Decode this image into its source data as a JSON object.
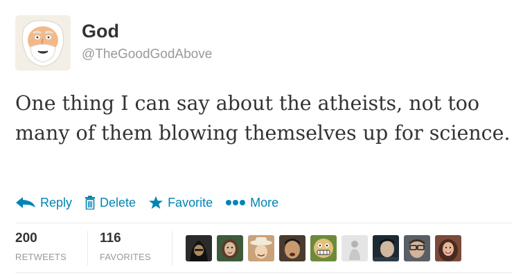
{
  "user": {
    "name": "God",
    "handle": "@TheGoodGodAbove"
  },
  "tweet": {
    "text": "One thing I can say about the atheists, not too many of them blowing themselves up for science."
  },
  "actions": [
    {
      "label": "Reply",
      "icon": "reply-arrow-icon"
    },
    {
      "label": "Delete",
      "icon": "trash-icon"
    },
    {
      "label": "Favorite",
      "icon": "star-icon"
    },
    {
      "label": "More",
      "icon": "more-dots-icon"
    }
  ],
  "stats": {
    "retweets": {
      "count": "200",
      "label": "RETWEETS"
    },
    "favorites": {
      "count": "116",
      "label": "FAVORITES"
    }
  },
  "favoriter_avatars": [
    {
      "icon": "avatar-dark-hood",
      "bg": "#2b2b2b",
      "fg": "#b08a5a"
    },
    {
      "icon": "avatar-woman-green",
      "bg": "#3d5a3a",
      "fg": "#d7b99a"
    },
    {
      "icon": "avatar-cowboy",
      "bg": "#c9a27a",
      "fg": "#f2d4b5"
    },
    {
      "icon": "avatar-man-dark",
      "bg": "#4a3b2e",
      "fg": "#c89a6e"
    },
    {
      "icon": "avatar-cartoon-grin",
      "bg": "#6d8a3b",
      "fg": "#e1c27a"
    },
    {
      "icon": "avatar-light-figure",
      "bg": "#e5e5e5",
      "fg": "#b3b3b3"
    },
    {
      "icon": "avatar-man-profile",
      "bg": "#1e2a33",
      "fg": "#cfb7a0"
    },
    {
      "icon": "avatar-man-glasses",
      "bg": "#5a5f66",
      "fg": "#d3b49a"
    },
    {
      "icon": "avatar-woman-smile",
      "bg": "#7a4a3a",
      "fg": "#e3b89a"
    }
  ],
  "colors": {
    "link": "#0084b4",
    "text": "#333333",
    "muted": "#999999",
    "divider": "#e8e8e8"
  }
}
